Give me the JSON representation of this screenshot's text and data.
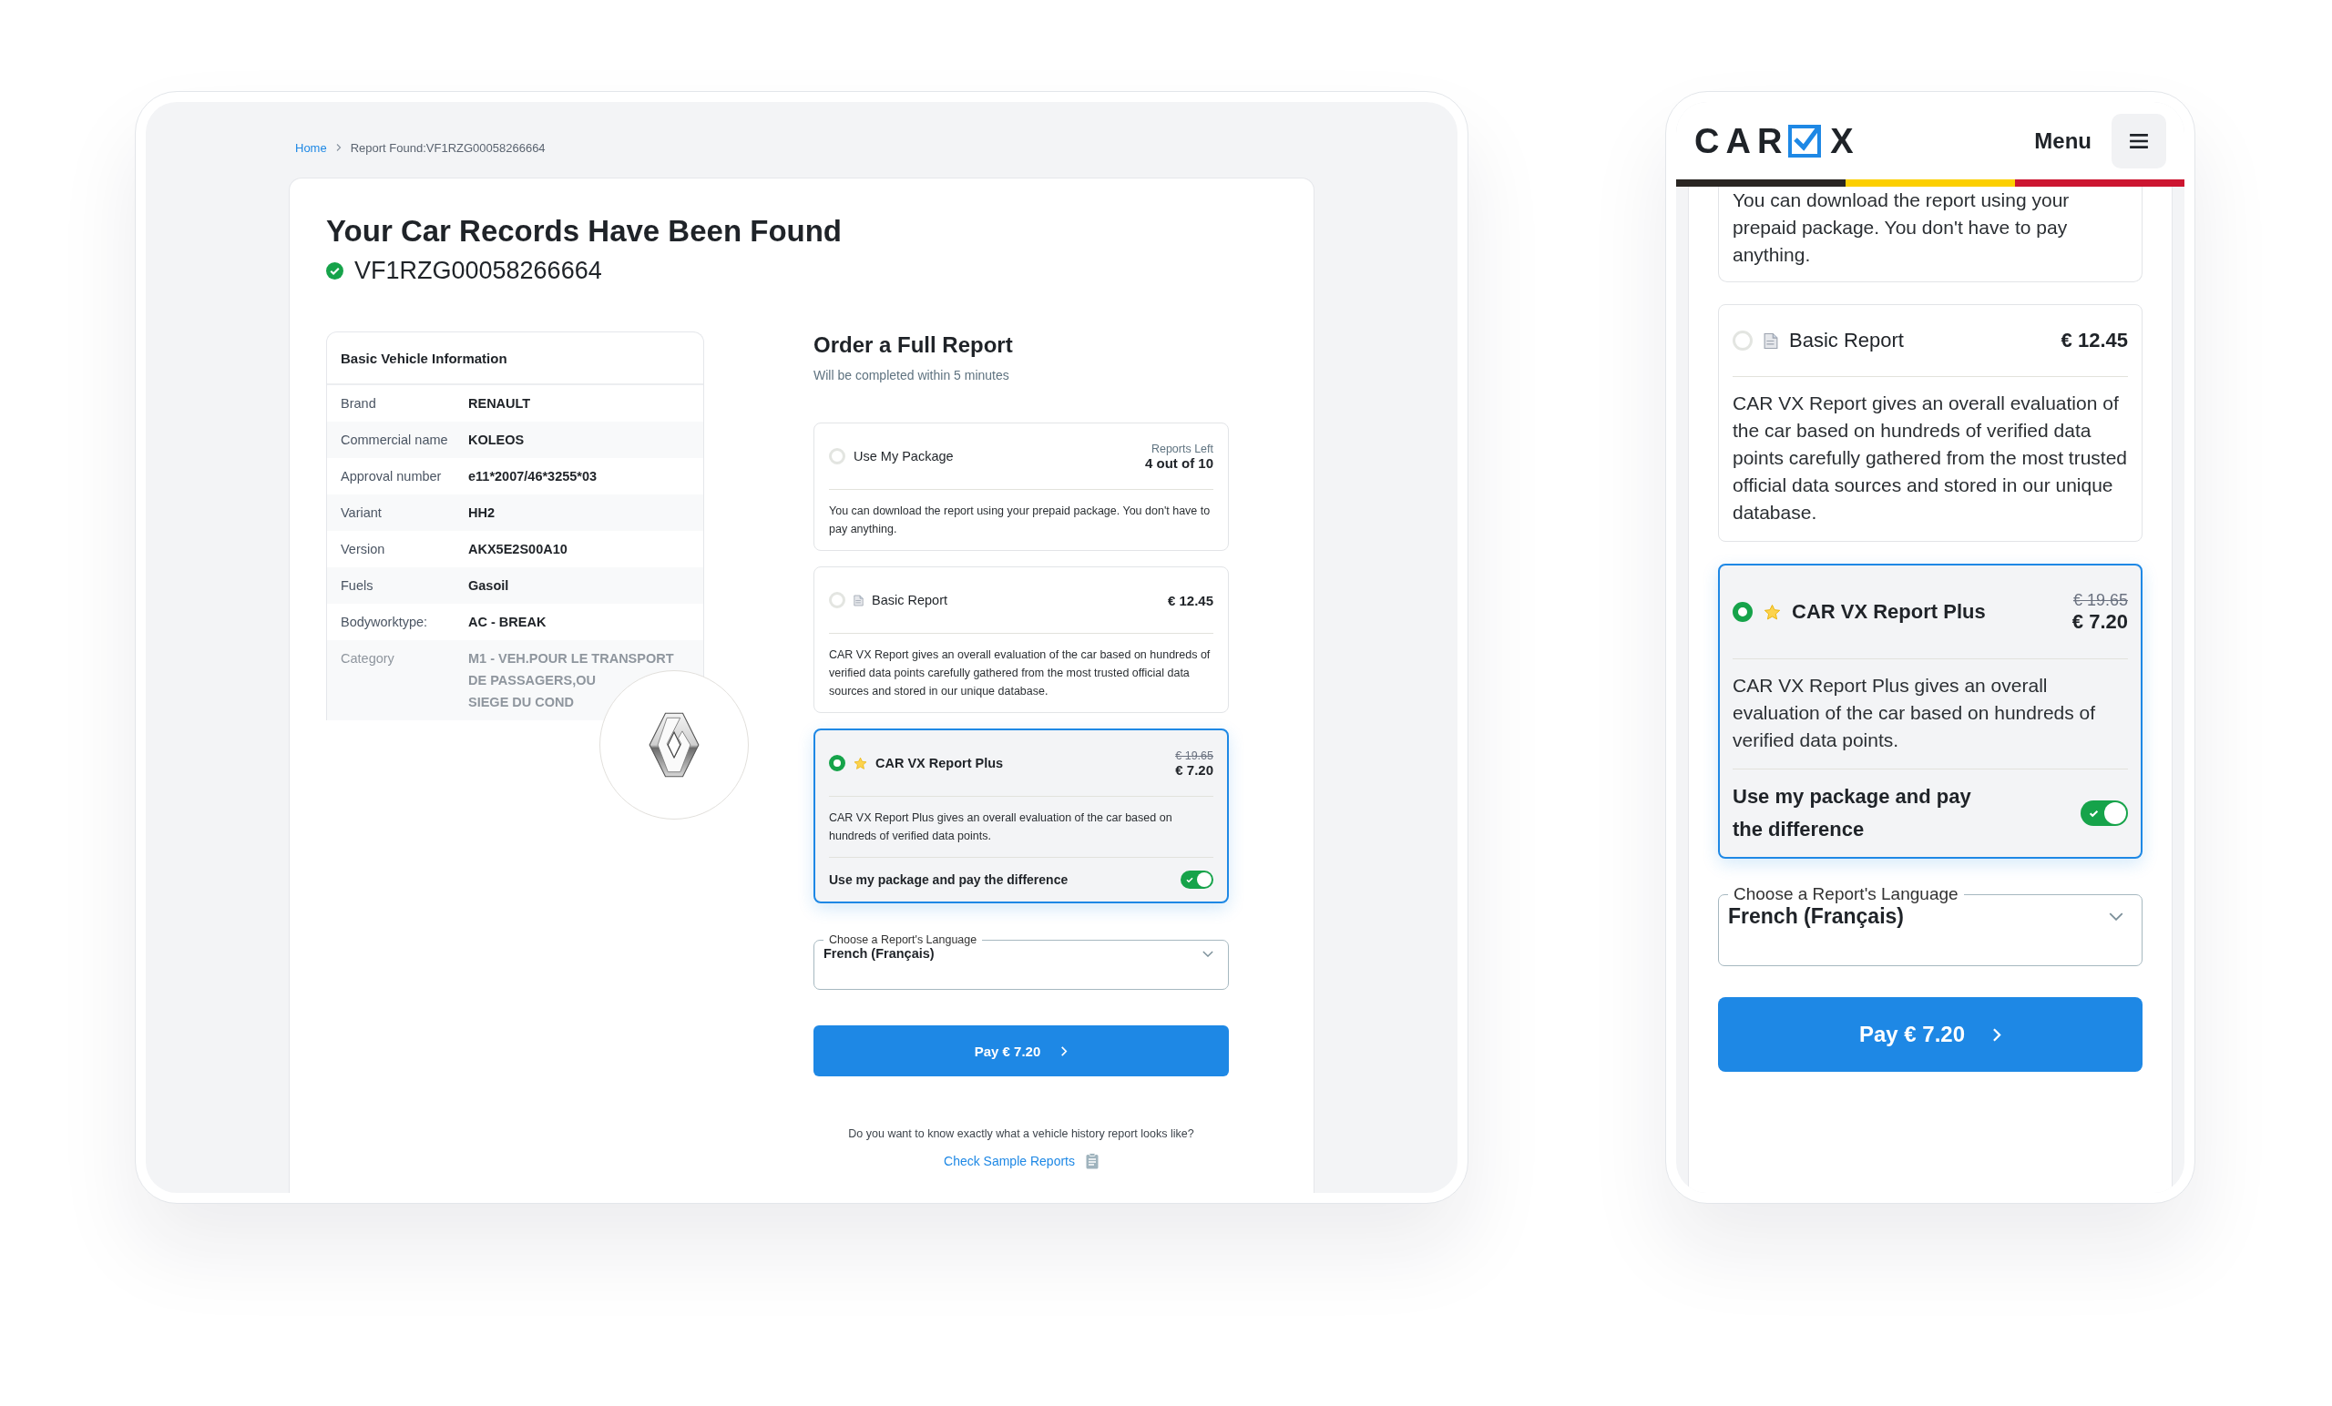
{
  "desktop": {
    "breadcrumb": [
      {
        "label": "Home",
        "kind": "link"
      },
      {
        "label": "Report Found:VF1RZG00058266664",
        "kind": "current"
      }
    ],
    "title": "Your Car Records Have Been Found",
    "vin": "VF1RZG00058266664",
    "vehicle_info": {
      "title": "Basic Vehicle Information",
      "rows": [
        {
          "label": "Brand",
          "value": "RENAULT",
          "faded": false
        },
        {
          "label": "Commercial name",
          "value": "KOLEOS",
          "faded": false
        },
        {
          "label": "Approval number",
          "value": "e11*2007/46*3255*03",
          "faded": false
        },
        {
          "label": "Variant",
          "value": "HH2",
          "faded": false
        },
        {
          "label": "Version",
          "value": "AKX5E2S00A10",
          "faded": false
        },
        {
          "label": "Fuels",
          "value": "Gasoil",
          "faded": false
        },
        {
          "label": "Bodyworktype:",
          "value": "AC - BREAK",
          "faded": false
        },
        {
          "label": "Category",
          "value_lines": [
            "M1 - VEH.POUR LE TRANSPORT",
            "DE PASSAGERS,OU",
            "SIEGE DU COND"
          ],
          "faded": true
        }
      ]
    },
    "order": {
      "title": "Order a Full Report",
      "subtitle": "Will be completed within 5 minutes",
      "options": [
        {
          "kind": "package",
          "label": "Use My Package",
          "selected": false,
          "reports_left_label": "Reports Left",
          "reports_left": "4 out of 10",
          "description": "You can download the report using your prepaid package. You don't have to pay anything."
        },
        {
          "kind": "basic",
          "label": "Basic Report",
          "selected": false,
          "price": "€ 12.45",
          "description": "CAR VX Report gives an overall evaluation of the car based on hundreds of verified data points carefully gathered from the most trusted official data sources and stored in our unique database."
        },
        {
          "kind": "plus",
          "label": "CAR VX Report Plus",
          "selected": true,
          "old_price": "€ 19.65",
          "price": "€ 7.20",
          "description": "CAR VX Report Plus gives an overall evaluation of the car based on hundreds of verified data points.",
          "toggle": {
            "label": "Use my package and pay the difference",
            "on": true
          }
        }
      ],
      "language": {
        "label": "Choose a Report's Language",
        "value": "French (Français)"
      },
      "pay_button": "Pay € 7.20",
      "sample_prompt": "Do you want to know exactly what a vehicle history report looks like?",
      "sample_link": "Check Sample Reports"
    }
  },
  "mobile": {
    "logo": {
      "left": "CAR",
      "right": "X"
    },
    "menu_label": "Menu",
    "options": [
      {
        "kind": "package",
        "selected": false,
        "description": "You can download the report using your prepaid package. You don't have to pay anything."
      },
      {
        "kind": "basic",
        "label": "Basic Report",
        "selected": false,
        "price": "€ 12.45",
        "description": "CAR VX Report gives an overall evaluation of the car based on hundreds of verified data points carefully gathered from the most trusted official data sources and stored in our unique database."
      },
      {
        "kind": "plus",
        "label": "CAR VX Report Plus",
        "selected": true,
        "old_price": "€ 19.65",
        "price": "€ 7.20",
        "description": "CAR VX Report Plus gives an overall evaluation of the car based on hundreds of verified data points.",
        "toggle": {
          "label": "Use my package and pay the difference",
          "on": true
        }
      }
    ],
    "language": {
      "label": "Choose a Report's Language",
      "value": "French (Français)"
    },
    "pay_button": "Pay € 7.20"
  }
}
